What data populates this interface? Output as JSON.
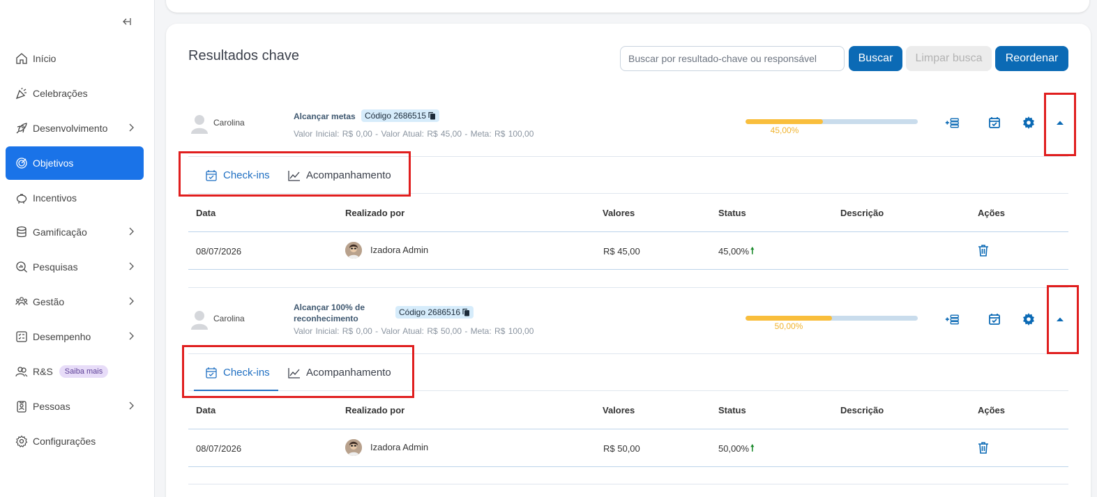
{
  "colors": {
    "accent": "#1a73e8",
    "brand_button": "#0b6ab5",
    "progress": "#f9be3c",
    "highlight": "#e01e1e",
    "status_up": "#1b8a2c"
  },
  "sidebar": {
    "collapse_icon": "collapse-left-icon",
    "items": [
      {
        "label": "Início",
        "icon": "home-icon",
        "has_chevron": false
      },
      {
        "label": "Celebrações",
        "icon": "party-icon",
        "has_chevron": false
      },
      {
        "label": "Desenvolvimento",
        "icon": "rocket-icon",
        "has_chevron": true
      },
      {
        "label": "Objetivos",
        "icon": "target-icon",
        "has_chevron": false,
        "active": true
      },
      {
        "label": "Incentivos",
        "icon": "piggy-bank-icon",
        "has_chevron": false
      },
      {
        "label": "Gamificação",
        "icon": "coins-icon",
        "has_chevron": true
      },
      {
        "label": "Pesquisas",
        "icon": "search-chart-icon",
        "has_chevron": true
      },
      {
        "label": "Gestão",
        "icon": "team-icon",
        "has_chevron": true
      },
      {
        "label": "Desempenho",
        "icon": "checklist-icon",
        "has_chevron": true
      },
      {
        "label": "R&S",
        "icon": "recruit-icon",
        "has_chevron": false,
        "badge": "Saiba mais"
      },
      {
        "label": "Pessoas",
        "icon": "id-badge-icon",
        "has_chevron": true
      },
      {
        "label": "Configurações",
        "icon": "gear-icon",
        "has_chevron": false
      }
    ]
  },
  "main": {
    "title": "Resultados chave",
    "search": {
      "placeholder": "Buscar por resultado-chave ou responsável",
      "value": ""
    },
    "buttons": {
      "search": "Buscar",
      "clear": "Limpar busca",
      "reorder": "Reordenar"
    }
  },
  "key_results": [
    {
      "owner": "Carolina",
      "title_lines": [
        "Alcançar metas"
      ],
      "code": "Código 2686515",
      "values": "Valor Inicial: R$ 0,00  -   Valor Atual: R$ 45,00  -   Meta: R$ 100,00",
      "progress_percent": 45,
      "progress_label": "45,00%",
      "tabs": [
        "Check-ins",
        "Acompanhamento"
      ],
      "table": {
        "headers": [
          "Data",
          "Realizado por",
          "Valores",
          "Status",
          "Descrição",
          "Ações"
        ],
        "rows": [
          {
            "date": "08/07/2026",
            "by": "Izadora Admin",
            "value": "R$ 45,00",
            "status": "45,00%",
            "status_icon": "arrow-up-icon",
            "description": ""
          }
        ]
      }
    },
    {
      "owner": "Carolina",
      "title_lines": [
        "Alcançar 100% de",
        "reconhecimento"
      ],
      "code": "Código 2686516",
      "values": "Valor Inicial: R$ 0,00  -   Valor Atual: R$ 50,00  -   Meta: R$ 100,00",
      "progress_percent": 50,
      "progress_label": "50,00%",
      "tabs": [
        "Check-ins",
        "Acompanhamento"
      ],
      "table": {
        "headers": [
          "Data",
          "Realizado por",
          "Valores",
          "Status",
          "Descrição",
          "Ações"
        ],
        "rows": [
          {
            "date": "08/07/2026",
            "by": "Izadora Admin",
            "value": "R$ 50,00",
            "status": "50,00%",
            "status_icon": "arrow-up-icon",
            "description": ""
          }
        ]
      }
    }
  ]
}
